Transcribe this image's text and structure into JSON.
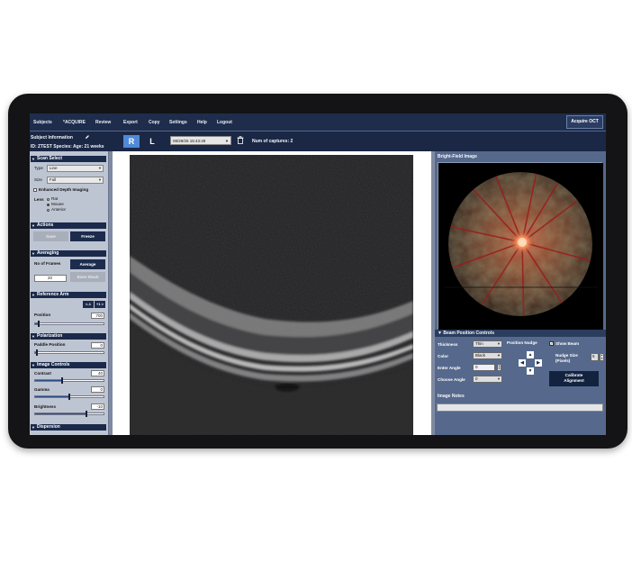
{
  "menu": {
    "items": [
      "Subjects",
      "*ACQUIRE",
      "Review",
      "Export",
      "Copy",
      "Settings",
      "Help",
      "Logout"
    ],
    "acquire_button": "Acquire OCT"
  },
  "subject": {
    "info_label": "Subject Information",
    "line": "ID: ZTEST Species:  Age: 21 weeks",
    "right_label": "R",
    "left_label": "L",
    "date_value": "08/29/25 15:43:49",
    "captures_label": "Num of captures: 2"
  },
  "scan_select": {
    "title": "Scan Select",
    "type_label": "Type",
    "type_value": "Line",
    "size_label": "Size",
    "size_value": "Full",
    "edi_label": "Enhanced Depth Imaging",
    "lens_label": "Lens",
    "lens_options": [
      "Rat",
      "Mouse",
      "Anterior"
    ]
  },
  "actions": {
    "title": "Actions",
    "save": "Save",
    "freeze": "Freeze"
  },
  "averaging": {
    "title": "Averaging",
    "frames_label": "No of Frames",
    "average_button": "Average",
    "frames_value": "20",
    "save_stack": "Save Stack"
  },
  "reference_arm": {
    "title": "Reference Arm",
    "step_down": "<-1",
    "step_up": "+1 >",
    "position_label": "Position",
    "position_value": "700",
    "position_level": 0.05
  },
  "polarization": {
    "title": "Polarization",
    "paddle_label": "Paddle Position",
    "paddle_value": "0",
    "paddle_level": 0.02
  },
  "image_controls": {
    "title": "Image Controls",
    "contrast_label": "Contrast",
    "contrast_value": "40",
    "contrast_level": 0.4,
    "gamma_label": "Gamma",
    "gamma_value": "0",
    "gamma_level": 0.5,
    "brightness_label": "Brightness",
    "brightness_value": "-10",
    "brightness_level": 0.75
  },
  "dispersion": {
    "title": "Dispersion"
  },
  "bright_field": {
    "title": "Bright-Field Image"
  },
  "beam": {
    "title": "Beam Position Controls",
    "thickness_label": "Thickness",
    "thickness_value": "Thin",
    "color_label": "Color",
    "color_value": "Black",
    "enter_angle_label": "Enter Angle",
    "enter_angle_value": "0",
    "choose_angle_label": "Choose Angle",
    "choose_angle_value": "0",
    "nudge_label": "Position Nudge",
    "show_beam_label": "Show Beam",
    "nudge_size_label": "Nudge Size (Pixels)",
    "nudge_size_value": "5",
    "calibrate_line1": "Calibrate",
    "calibrate_line2": "Alignment"
  },
  "notes": {
    "title": "Image Notes"
  },
  "colors": {
    "menubar": "#1e2d4c",
    "panel": "#56698c",
    "section_header": "#1b2a4a",
    "accent_button": "#4f8ad8"
  }
}
